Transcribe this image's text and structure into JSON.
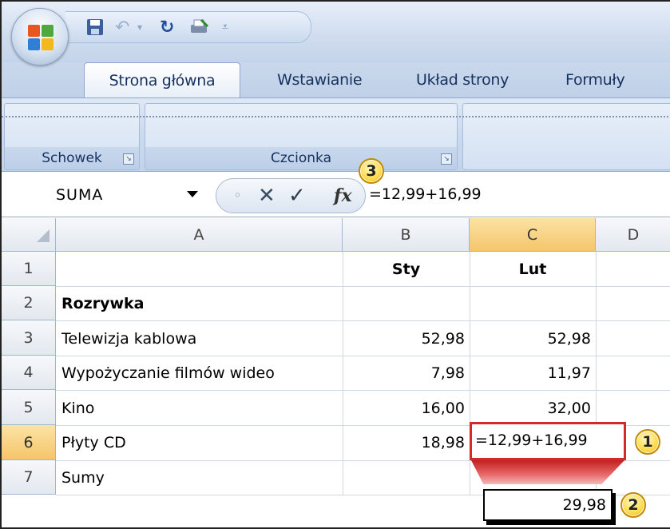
{
  "ribbon": {
    "office_button": "office-button",
    "tabs": [
      "Strona główna",
      "Wstawianie",
      "Układ strony",
      "Formuły"
    ],
    "groups": [
      "Schowek",
      "Czcionka"
    ]
  },
  "formula_bar": {
    "name_box": "SUMA",
    "fx_label": "fx",
    "formula": "=12,99+16,99"
  },
  "sheet": {
    "columns": [
      "A",
      "B",
      "C",
      "D"
    ],
    "rows": [
      "1",
      "2",
      "3",
      "4",
      "5",
      "6",
      "7"
    ],
    "selected_column": "C",
    "selected_row": "6",
    "cells": {
      "B1": "Sty",
      "C1": "Lut",
      "A2": "Rozrywka",
      "A3": "Telewizja kablowa",
      "B3": "52,98",
      "C3": "52,98",
      "A4": "Wypożyczanie filmów wideo",
      "B4": "7,98",
      "C4": "11,97",
      "A5": "Kino",
      "B5": "16,00",
      "C5": "32,00",
      "A6": "Płyty CD",
      "B6": "18,98",
      "C6": "=12,99+16,99",
      "A7": "Sumy"
    },
    "result_value": "29,98"
  },
  "callouts": [
    "1",
    "2",
    "3"
  ],
  "colors": {
    "accent_red": "#d02a2a",
    "callout_yellow": "#ffd94a",
    "ribbon_blue": "#c9d8ec",
    "selected_header": "#f5c56a"
  }
}
